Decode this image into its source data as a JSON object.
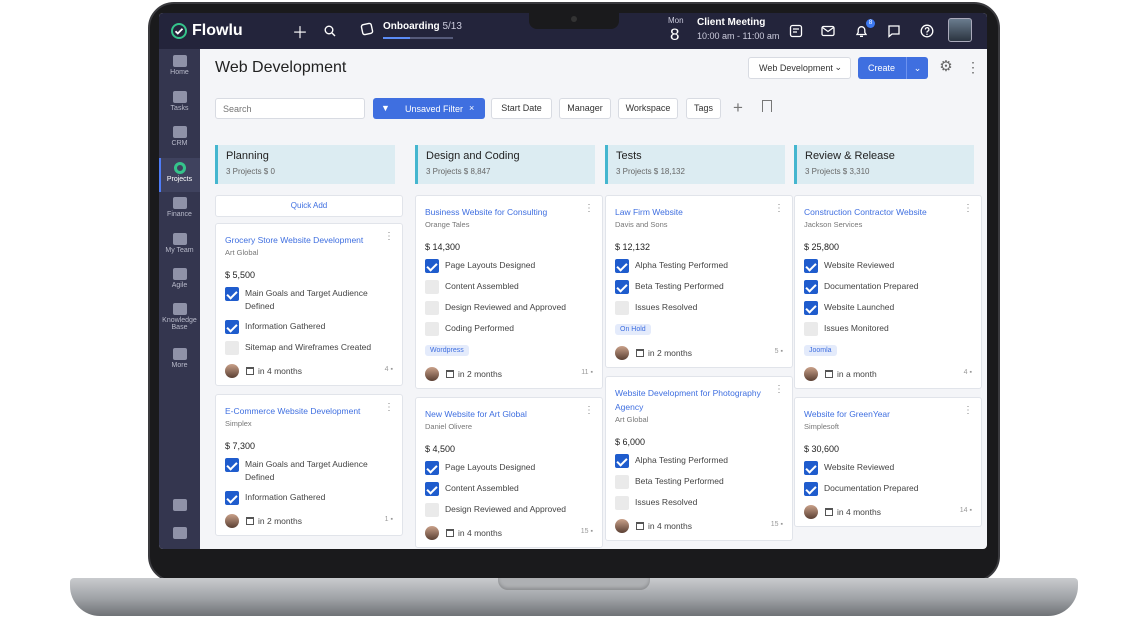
{
  "app": {
    "name": "Flowlu"
  },
  "topbar": {
    "onboarding_label": "Onboarding",
    "onboarding_count": "5/13",
    "onboarding_progress": 0.38,
    "meeting_weekday": "Mon",
    "meeting_day": "8",
    "meeting_title": "Client Meeting",
    "meeting_time": "10:00 am - 11:00 am",
    "notification_count": "8"
  },
  "sidebar": {
    "items": [
      {
        "label": "Home"
      },
      {
        "label": "Tasks"
      },
      {
        "label": "CRM"
      },
      {
        "label": "Projects"
      },
      {
        "label": "Finance"
      },
      {
        "label": "My Team"
      },
      {
        "label": "Agile"
      },
      {
        "label": "Knowledge Base"
      },
      {
        "label": "More"
      }
    ]
  },
  "header": {
    "title": "Web Development",
    "project_select": "Web Development",
    "create_label": "Create"
  },
  "filters": {
    "search_placeholder": "Search",
    "active_filter": "Unsaved Filter",
    "buttons": [
      "Start Date",
      "Manager",
      "Workspace",
      "Tags"
    ]
  },
  "columns": [
    {
      "name": "Planning",
      "meta": "3 Projects   $ 0",
      "quick_add": "Quick Add",
      "cards": [
        {
          "title": "Grocery Store Website Development",
          "client": "Art Global",
          "amount": "$ 5,500",
          "checks": [
            {
              "t": "Main Goals and Target Audience Defined",
              "on": true
            },
            {
              "t": "Information Gathered",
              "on": true
            },
            {
              "t": "Sitemap and Wireframes Created",
              "on": false
            }
          ],
          "tag": "",
          "due": "in 4 months",
          "comments": "4"
        },
        {
          "title": "E-Commerce Website Development",
          "client": "Simplex",
          "amount": "$ 7,300",
          "checks": [
            {
              "t": "Main Goals and Target Audience Defined",
              "on": true
            },
            {
              "t": "Information Gathered",
              "on": true
            }
          ],
          "tag": "",
          "due": "in 2 months",
          "comments": "1"
        }
      ]
    },
    {
      "name": "Design and Coding",
      "meta": "3 Projects   $ 8,847",
      "cards": [
        {
          "title": "Business Website for Consulting",
          "client": "Orange Tales",
          "amount": "$ 14,300",
          "checks": [
            {
              "t": "Page Layouts Designed",
              "on": true
            },
            {
              "t": "Content Assembled",
              "on": false
            },
            {
              "t": "Design Reviewed and Approved",
              "on": false
            },
            {
              "t": "Coding Performed",
              "on": false
            }
          ],
          "tag": "Wordpress",
          "due": "in 2 months",
          "comments": "11"
        },
        {
          "title": "New Website for Art Global",
          "client": "Daniel Olivere",
          "amount": "$ 4,500",
          "checks": [
            {
              "t": "Page Layouts Designed",
              "on": true
            },
            {
              "t": "Content Assembled",
              "on": true
            },
            {
              "t": "Design Reviewed and Approved",
              "on": false
            }
          ],
          "tag": "",
          "due": "in 4 months",
          "comments": "15"
        }
      ]
    },
    {
      "name": "Tests",
      "meta": "3 Projects   $ 18,132",
      "cards": [
        {
          "title": "Law Firm Website",
          "client": "Davis and Sons",
          "amount": "$ 12,132",
          "checks": [
            {
              "t": "Alpha Testing Performed",
              "on": true
            },
            {
              "t": "Beta Testing Performed",
              "on": true
            },
            {
              "t": "Issues Resolved",
              "on": false
            }
          ],
          "tag": "On Hold",
          "due": "in 2 months",
          "comments": "5"
        },
        {
          "title": "Website Development for Photography Agency",
          "client": "Art Global",
          "amount": "$ 6,000",
          "checks": [
            {
              "t": "Alpha Testing Performed",
              "on": true
            },
            {
              "t": "Beta Testing Performed",
              "on": false
            },
            {
              "t": "Issues Resolved",
              "on": false
            }
          ],
          "tag": "",
          "due": "in 4 months",
          "comments": "15"
        }
      ]
    },
    {
      "name": "Review & Release",
      "meta": "3 Projects   $ 3,310",
      "cards": [
        {
          "title": "Construction Contractor Website",
          "client": "Jackson Services",
          "amount": "$ 25,800",
          "checks": [
            {
              "t": "Website Reviewed",
              "on": true
            },
            {
              "t": "Documentation Prepared",
              "on": true
            },
            {
              "t": "Website Launched",
              "on": true
            },
            {
              "t": "Issues Monitored",
              "on": false
            }
          ],
          "tag": "Joomla",
          "due": "in a month",
          "comments": "4"
        },
        {
          "title": "Website for GreenYear",
          "client": "Simplesoft",
          "amount": "$ 30,600",
          "checks": [
            {
              "t": "Website Reviewed",
              "on": true
            },
            {
              "t": "Documentation Prepared",
              "on": true
            }
          ],
          "tag": "",
          "due": "in 4 months",
          "comments": "14"
        }
      ]
    }
  ]
}
